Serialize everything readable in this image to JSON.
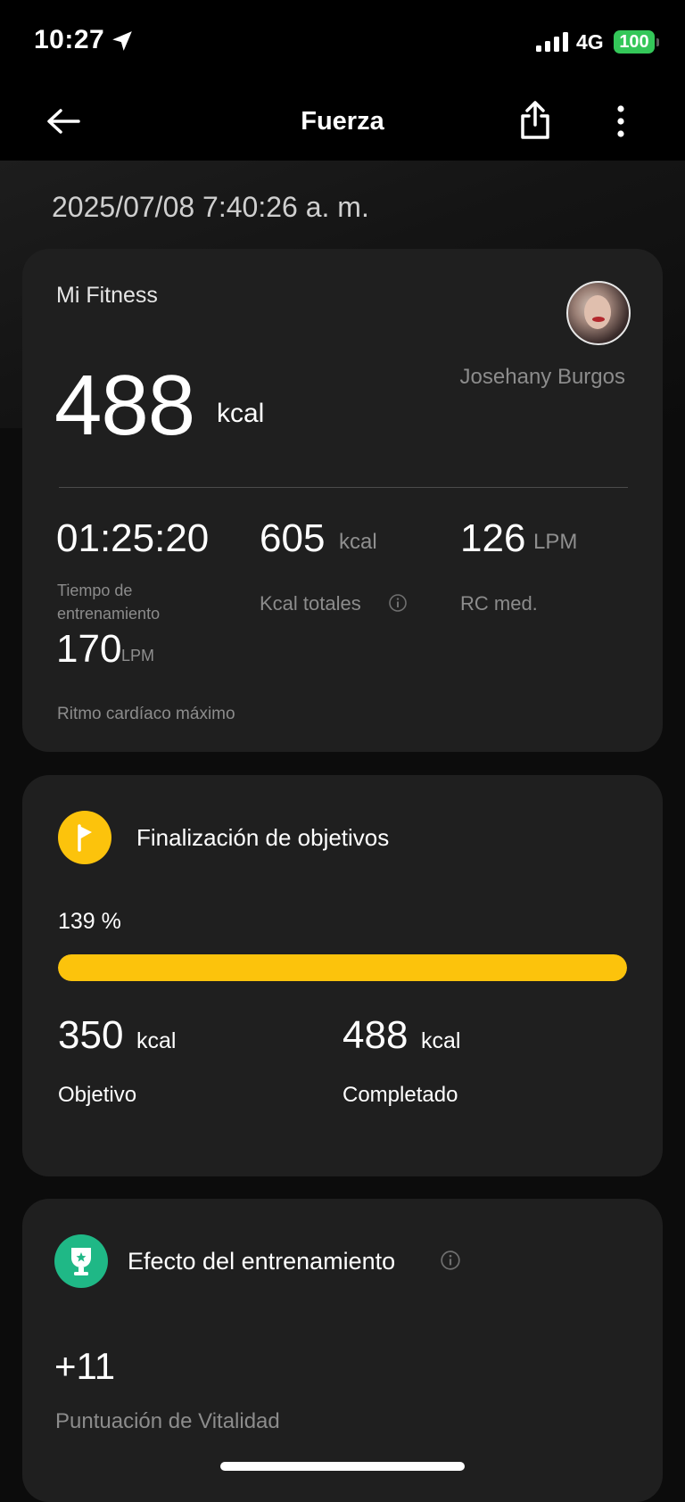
{
  "status_bar": {
    "time": "10:27",
    "network": "4G",
    "battery": "100"
  },
  "nav": {
    "title": "Fuerza"
  },
  "workout": {
    "datetime": "2025/07/08 7:40:26 a. m."
  },
  "summary_card": {
    "source": "Mi Fitness",
    "user_name": "Josehany Burgos",
    "calories": {
      "value": "488",
      "unit": "kcal"
    },
    "stats": {
      "duration": {
        "value": "01:25:20",
        "label_line1": "Tiempo de",
        "label_line2": "entrenamiento"
      },
      "total_kcal": {
        "value": "605",
        "unit": "kcal",
        "label": "Kcal totales"
      },
      "avg_hr": {
        "value": "126",
        "unit": "LPM",
        "label": "RC med."
      },
      "max_hr": {
        "value": "170",
        "unit": "LPM",
        "label": "Ritmo cardíaco máximo"
      }
    }
  },
  "goal_card": {
    "title": "Finalización de objetivos",
    "percent_text": "139 %",
    "progress_fraction": 1.0,
    "accent_color": "#fcc30c",
    "target": {
      "value": "350",
      "unit": "kcal",
      "label": "Objetivo"
    },
    "completed": {
      "value": "488",
      "unit": "kcal",
      "label": "Completado"
    }
  },
  "effect_card": {
    "title": "Efecto del entrenamiento",
    "accent_color": "#1fb886",
    "score": "+11",
    "score_label": "Puntuación de Vitalidad"
  }
}
